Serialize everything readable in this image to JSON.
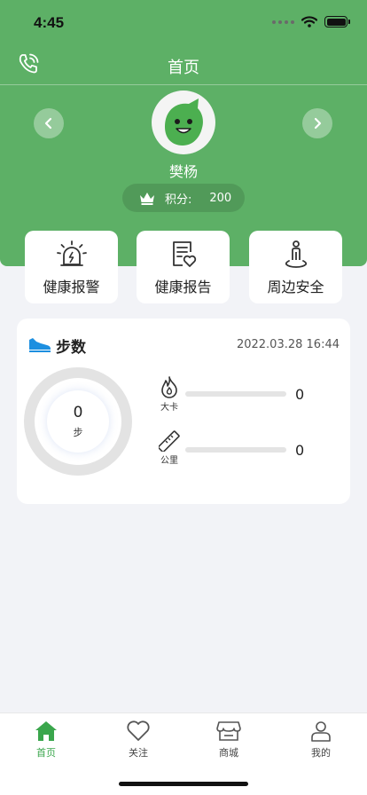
{
  "status_bar": {
    "time": "4:45"
  },
  "nav": {
    "title": "首页"
  },
  "profile": {
    "name": "樊杨",
    "points_label": "积分:",
    "points_value": "200"
  },
  "features": [
    {
      "label": "健康报警",
      "icon": "alarm-light-icon"
    },
    {
      "label": "健康报告",
      "icon": "report-heart-icon"
    },
    {
      "label": "周边安全",
      "icon": "location-person-icon"
    }
  ],
  "steps": {
    "title": "步数",
    "date": "2022.03.28 16:44",
    "count": "0",
    "unit": "步",
    "calories_label": "大卡",
    "calories_value": "0",
    "distance_label": "公里",
    "distance_value": "0"
  },
  "tabs": [
    {
      "label": "首页",
      "icon": "home-icon",
      "active": true
    },
    {
      "label": "关注",
      "icon": "heart-icon",
      "active": false
    },
    {
      "label": "商城",
      "icon": "store-icon",
      "active": false
    },
    {
      "label": "我的",
      "icon": "user-icon",
      "active": false
    }
  ],
  "colors": {
    "brand_green": "#5db066",
    "tab_active": "#3aa64c",
    "accent_blue": "#1d8fe0"
  }
}
